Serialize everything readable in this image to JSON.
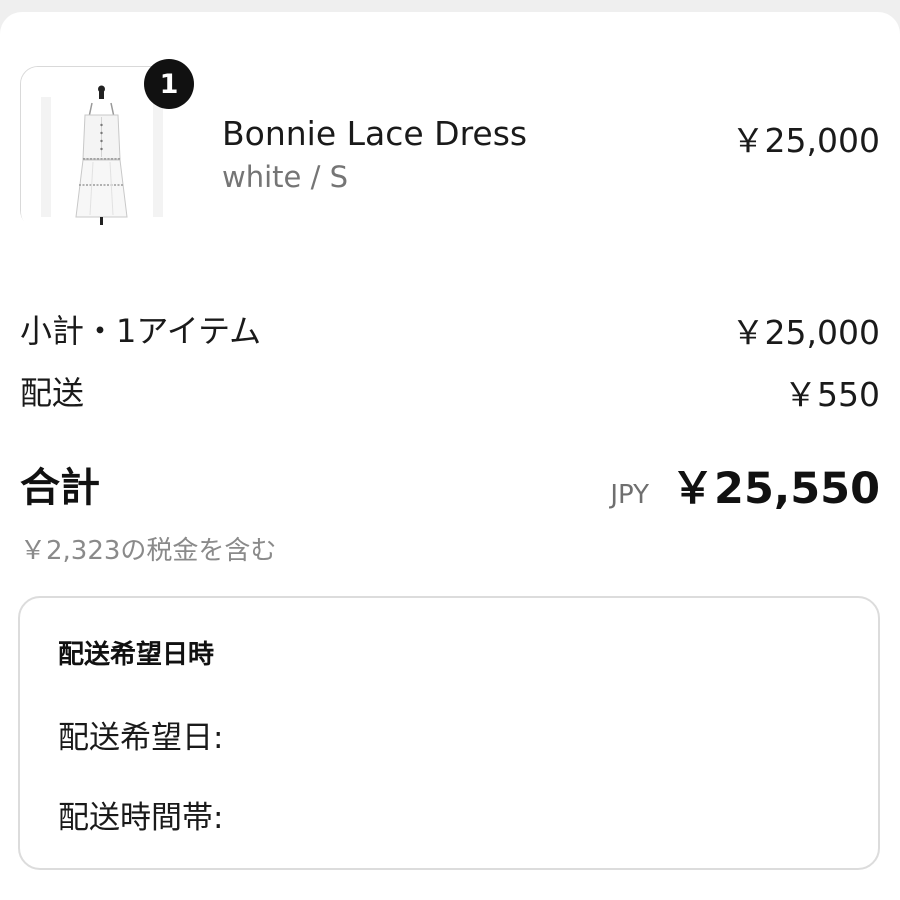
{
  "product": {
    "quantity": "1",
    "name": "Bonnie Lace Dress",
    "variant": "white / S",
    "price": "￥25,000",
    "image_icon": "dress-on-mannequin"
  },
  "summary": {
    "subtotal_label": "小計・1アイテム",
    "subtotal_value": "￥25,000",
    "shipping_label": "配送",
    "shipping_value": "￥550",
    "total_label": "合計",
    "currency": "JPY",
    "total_value": "￥25,550",
    "tax_note": "￥2,323の税金を含む"
  },
  "delivery": {
    "title": "配送希望日時",
    "date_label": "配送希望日:",
    "time_label": "配送時間帯:"
  },
  "colors": {
    "badge": "#111111",
    "muted_text": "#757575",
    "border": "#dcdcdc"
  }
}
